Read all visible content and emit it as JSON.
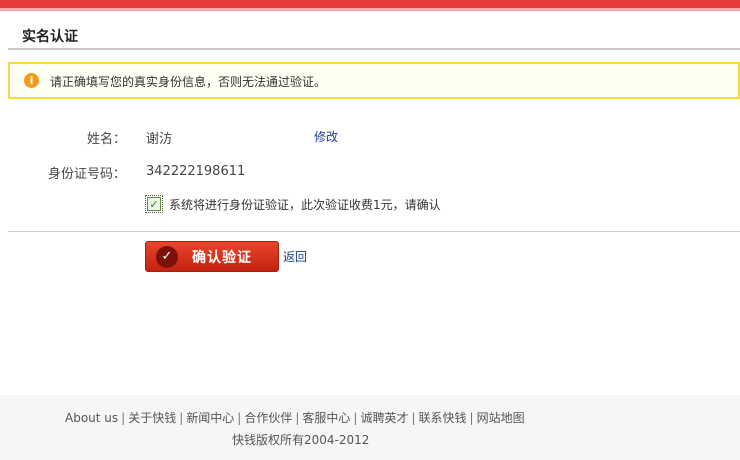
{
  "header": {
    "title": "实名认证"
  },
  "notice": {
    "icon": "info-icon",
    "text": "请正确填写您的真实身份信息，否则无法通过验证。"
  },
  "form": {
    "name_label": "姓名：",
    "name_value": "谢汸",
    "modify_link": "修改",
    "id_label": "身份证号码：",
    "id_value": "342222198611",
    "agree_checked": true,
    "agree_text": "系统将进行身份证验证，此次验证收费1元，请确认"
  },
  "actions": {
    "confirm_label": "确认验证",
    "back_label": "返回"
  },
  "footer": {
    "links": [
      "About us",
      "关于快钱",
      "新闻中心",
      "合作伙伴",
      "客服中心",
      "诚聘英才",
      "联系快钱",
      "网站地图"
    ],
    "copyright": "快钱版权所有2004-2012"
  },
  "colors": {
    "accent": "#e53d3d",
    "notice_border": "#f4da3c",
    "link": "#1a3e8c",
    "button": "#d2331b"
  }
}
